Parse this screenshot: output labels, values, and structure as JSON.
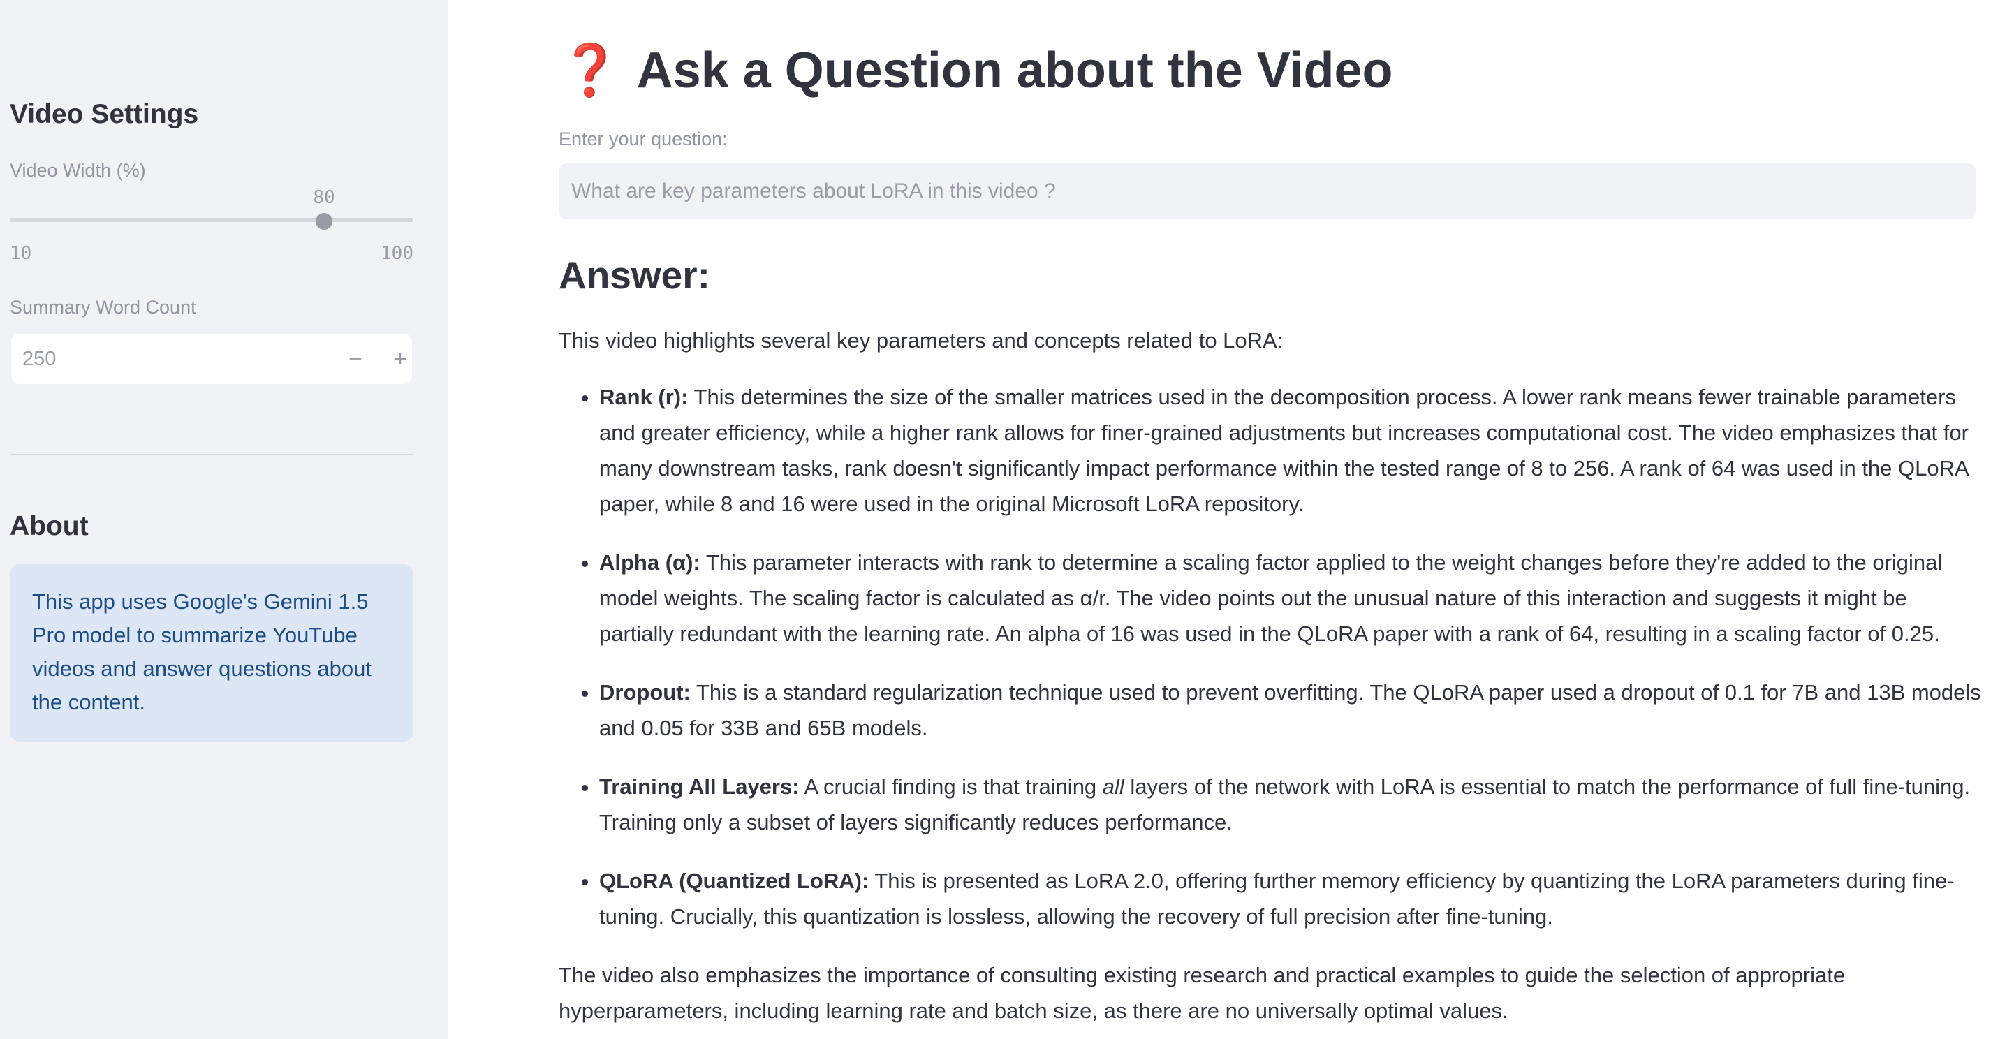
{
  "sidebar": {
    "settings_title": "Video Settings",
    "video_width": {
      "label": "Video Width (%)",
      "value": "80",
      "min": "10",
      "max": "100",
      "fraction": 0.778
    },
    "word_count": {
      "label": "Summary Word Count",
      "value": "250",
      "minus": "−",
      "plus": "+"
    },
    "about_title": "About",
    "about_text": "This app uses Google's Gemini 1.5 Pro model to summarize YouTube videos and answer questions about the content."
  },
  "main": {
    "title_icon": "❓",
    "title": "Ask a Question about the Video",
    "question_label": "Enter your question:",
    "question_placeholder": "What are key parameters about LoRA in this video ?",
    "answer_heading": "Answer:",
    "answer_intro": "This video highlights several key parameters and concepts related to LoRA:",
    "bullets": [
      {
        "lead": "Rank (r):",
        "text": " This determines the size of the smaller matrices used in the decomposition process. A lower rank means fewer trainable parameters and greater efficiency, while a higher rank allows for finer-grained adjustments but increases computational cost. The video emphasizes that for many downstream tasks, rank doesn't significantly impact performance within the tested range of 8 to 256. A rank of 64 was used in the QLoRA paper, while 8 and 16 were used in the original Microsoft LoRA repository."
      },
      {
        "lead": "Alpha (α):",
        "text": " This parameter interacts with rank to determine a scaling factor applied to the weight changes before they're added to the original model weights. The scaling factor is calculated as α/r. The video points out the unusual nature of this interaction and suggests it might be partially redundant with the learning rate. An alpha of 16 was used in the QLoRA paper with a rank of 64, resulting in a scaling factor of 0.25."
      },
      {
        "lead": "Dropout:",
        "text": " This is a standard regularization technique used to prevent overfitting. The QLoRA paper used a dropout of 0.1 for 7B and 13B models and 0.05 for 33B and 65B models."
      },
      {
        "lead": "Training All Layers:",
        "text_before": " A crucial finding is that training ",
        "text_em": "all",
        "text_after": " layers of the network with LoRA is essential to match the performance of full fine-tuning. Training only a subset of layers significantly reduces performance."
      },
      {
        "lead": "QLoRA (Quantized LoRA):",
        "text": " This is presented as LoRA 2.0, offering further memory efficiency by quantizing the LoRA parameters during fine-tuning. Crucially, this quantization is lossless, allowing the recovery of full precision after fine-tuning."
      }
    ],
    "answer_outro": "The video also emphasizes the importance of consulting existing research and practical examples to guide the selection of appropriate hyperparameters, including learning rate and batch size, as there are no universally optimal values."
  },
  "colors": {
    "sidebar_bg": "#f0f2f6",
    "info_bg": "#dce6f4",
    "info_text": "#1c4d86",
    "question_icon": "#e12222"
  }
}
